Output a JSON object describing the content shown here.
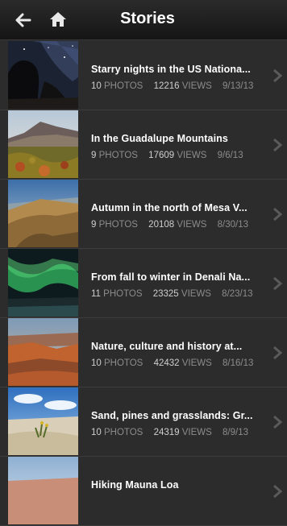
{
  "header": {
    "title": "Stories"
  },
  "stories": [
    {
      "title": "Starry nights in the US Nationa...",
      "photos": "10",
      "photos_label": "PHOTOS",
      "views": "12216",
      "views_label": "VIEWS",
      "date": "9/13/13"
    },
    {
      "title": "In the Guadalupe Mountains",
      "photos": "9",
      "photos_label": "PHOTOS",
      "views": "17609",
      "views_label": "VIEWS",
      "date": "9/6/13"
    },
    {
      "title": "Autumn in the north of Mesa V...",
      "photos": "9",
      "photos_label": "PHOTOS",
      "views": "20108",
      "views_label": "VIEWS",
      "date": "8/30/13"
    },
    {
      "title": "From fall to winter in Denali Na...",
      "photos": "11",
      "photos_label": "PHOTOS",
      "views": "23325",
      "views_label": "VIEWS",
      "date": "8/23/13"
    },
    {
      "title": "Nature, culture and history at...",
      "photos": "10",
      "photos_label": "PHOTOS",
      "views": "42432",
      "views_label": "VIEWS",
      "date": "8/16/13"
    },
    {
      "title": "Sand, pines and grasslands: Gr...",
      "photos": "10",
      "photos_label": "PHOTOS",
      "views": "24319",
      "views_label": "VIEWS",
      "date": "8/9/13"
    },
    {
      "title": "Hiking Mauna Loa"
    }
  ]
}
